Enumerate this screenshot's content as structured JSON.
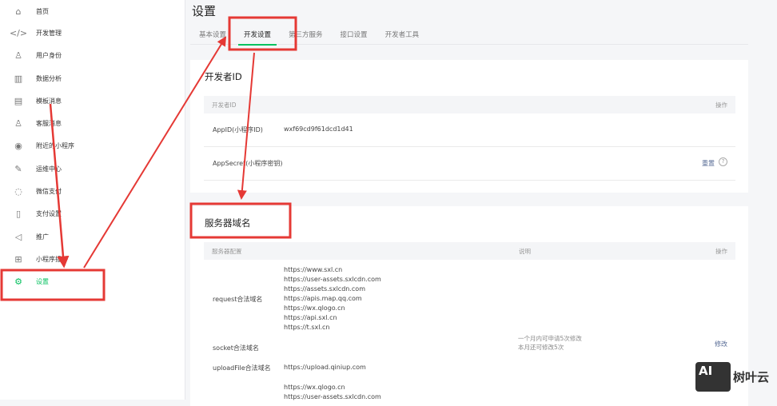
{
  "sidebar": {
    "items": [
      {
        "label": "首页",
        "icon": "home-icon"
      },
      {
        "label": "开发管理",
        "icon": "code-icon"
      },
      {
        "label": "用户身份",
        "icon": "user-icon"
      },
      {
        "label": "数据分析",
        "icon": "chart-icon"
      },
      {
        "label": "模板消息",
        "icon": "document-icon"
      },
      {
        "label": "客服消息",
        "icon": "user-icon"
      },
      {
        "label": "附近的小程序",
        "icon": "location-icon"
      },
      {
        "label": "运维中心",
        "icon": "wrench-icon"
      },
      {
        "label": "微信支付",
        "icon": "pay-icon"
      },
      {
        "label": "支付设置",
        "icon": "phone-settings-icon"
      },
      {
        "label": "推广",
        "icon": "megaphone-icon"
      },
      {
        "label": "小程序插件",
        "icon": "grid-icon"
      },
      {
        "label": "设置",
        "icon": "gear-icon",
        "active": true
      }
    ]
  },
  "header": {
    "title": "设置"
  },
  "tabs": [
    "基本设置",
    "开发设置",
    "第三方服务",
    "接口设置",
    "开发者工具"
  ],
  "developer_id": {
    "title": "开发者ID",
    "col_id": "开发者ID",
    "col_op": "操作",
    "appid_label": "AppID(小程序ID)",
    "appid_value": "wxf69cd9f61dcd1d41",
    "secret_label": "AppSecret(小程序密钥)",
    "reset": "重置",
    "help": "?"
  },
  "server_domain": {
    "title": "服务器域名",
    "col_config": "服务器配置",
    "col_desc": "说明",
    "col_op": "操作",
    "request_label": "request合法域名",
    "request_domains": [
      "https://www.sxl.cn",
      "https://user-assets.sxlcdn.com",
      "https://assets.sxlcdn.com",
      "https://apis.map.qq.com",
      "https://wx.qlogo.cn",
      "https://api.sxl.cn",
      "https://t.sxl.cn"
    ],
    "socket_label": "socket合法域名",
    "note1": "一个月内可申请5次修改",
    "note2": "本月还可修改5次",
    "modify": "修改",
    "upload_label": "uploadFile合法域名",
    "upload_domains": [
      "https://upload.qiniup.com"
    ],
    "download_domains": [
      "https://wx.qlogo.cn",
      "https://user-assets.sxlcdn.com"
    ]
  },
  "watermark": {
    "logo": "AI",
    "text": "树叶云"
  },
  "colors": {
    "accent": "#07c160",
    "annotation": "#e53935",
    "link": "#576b95"
  }
}
